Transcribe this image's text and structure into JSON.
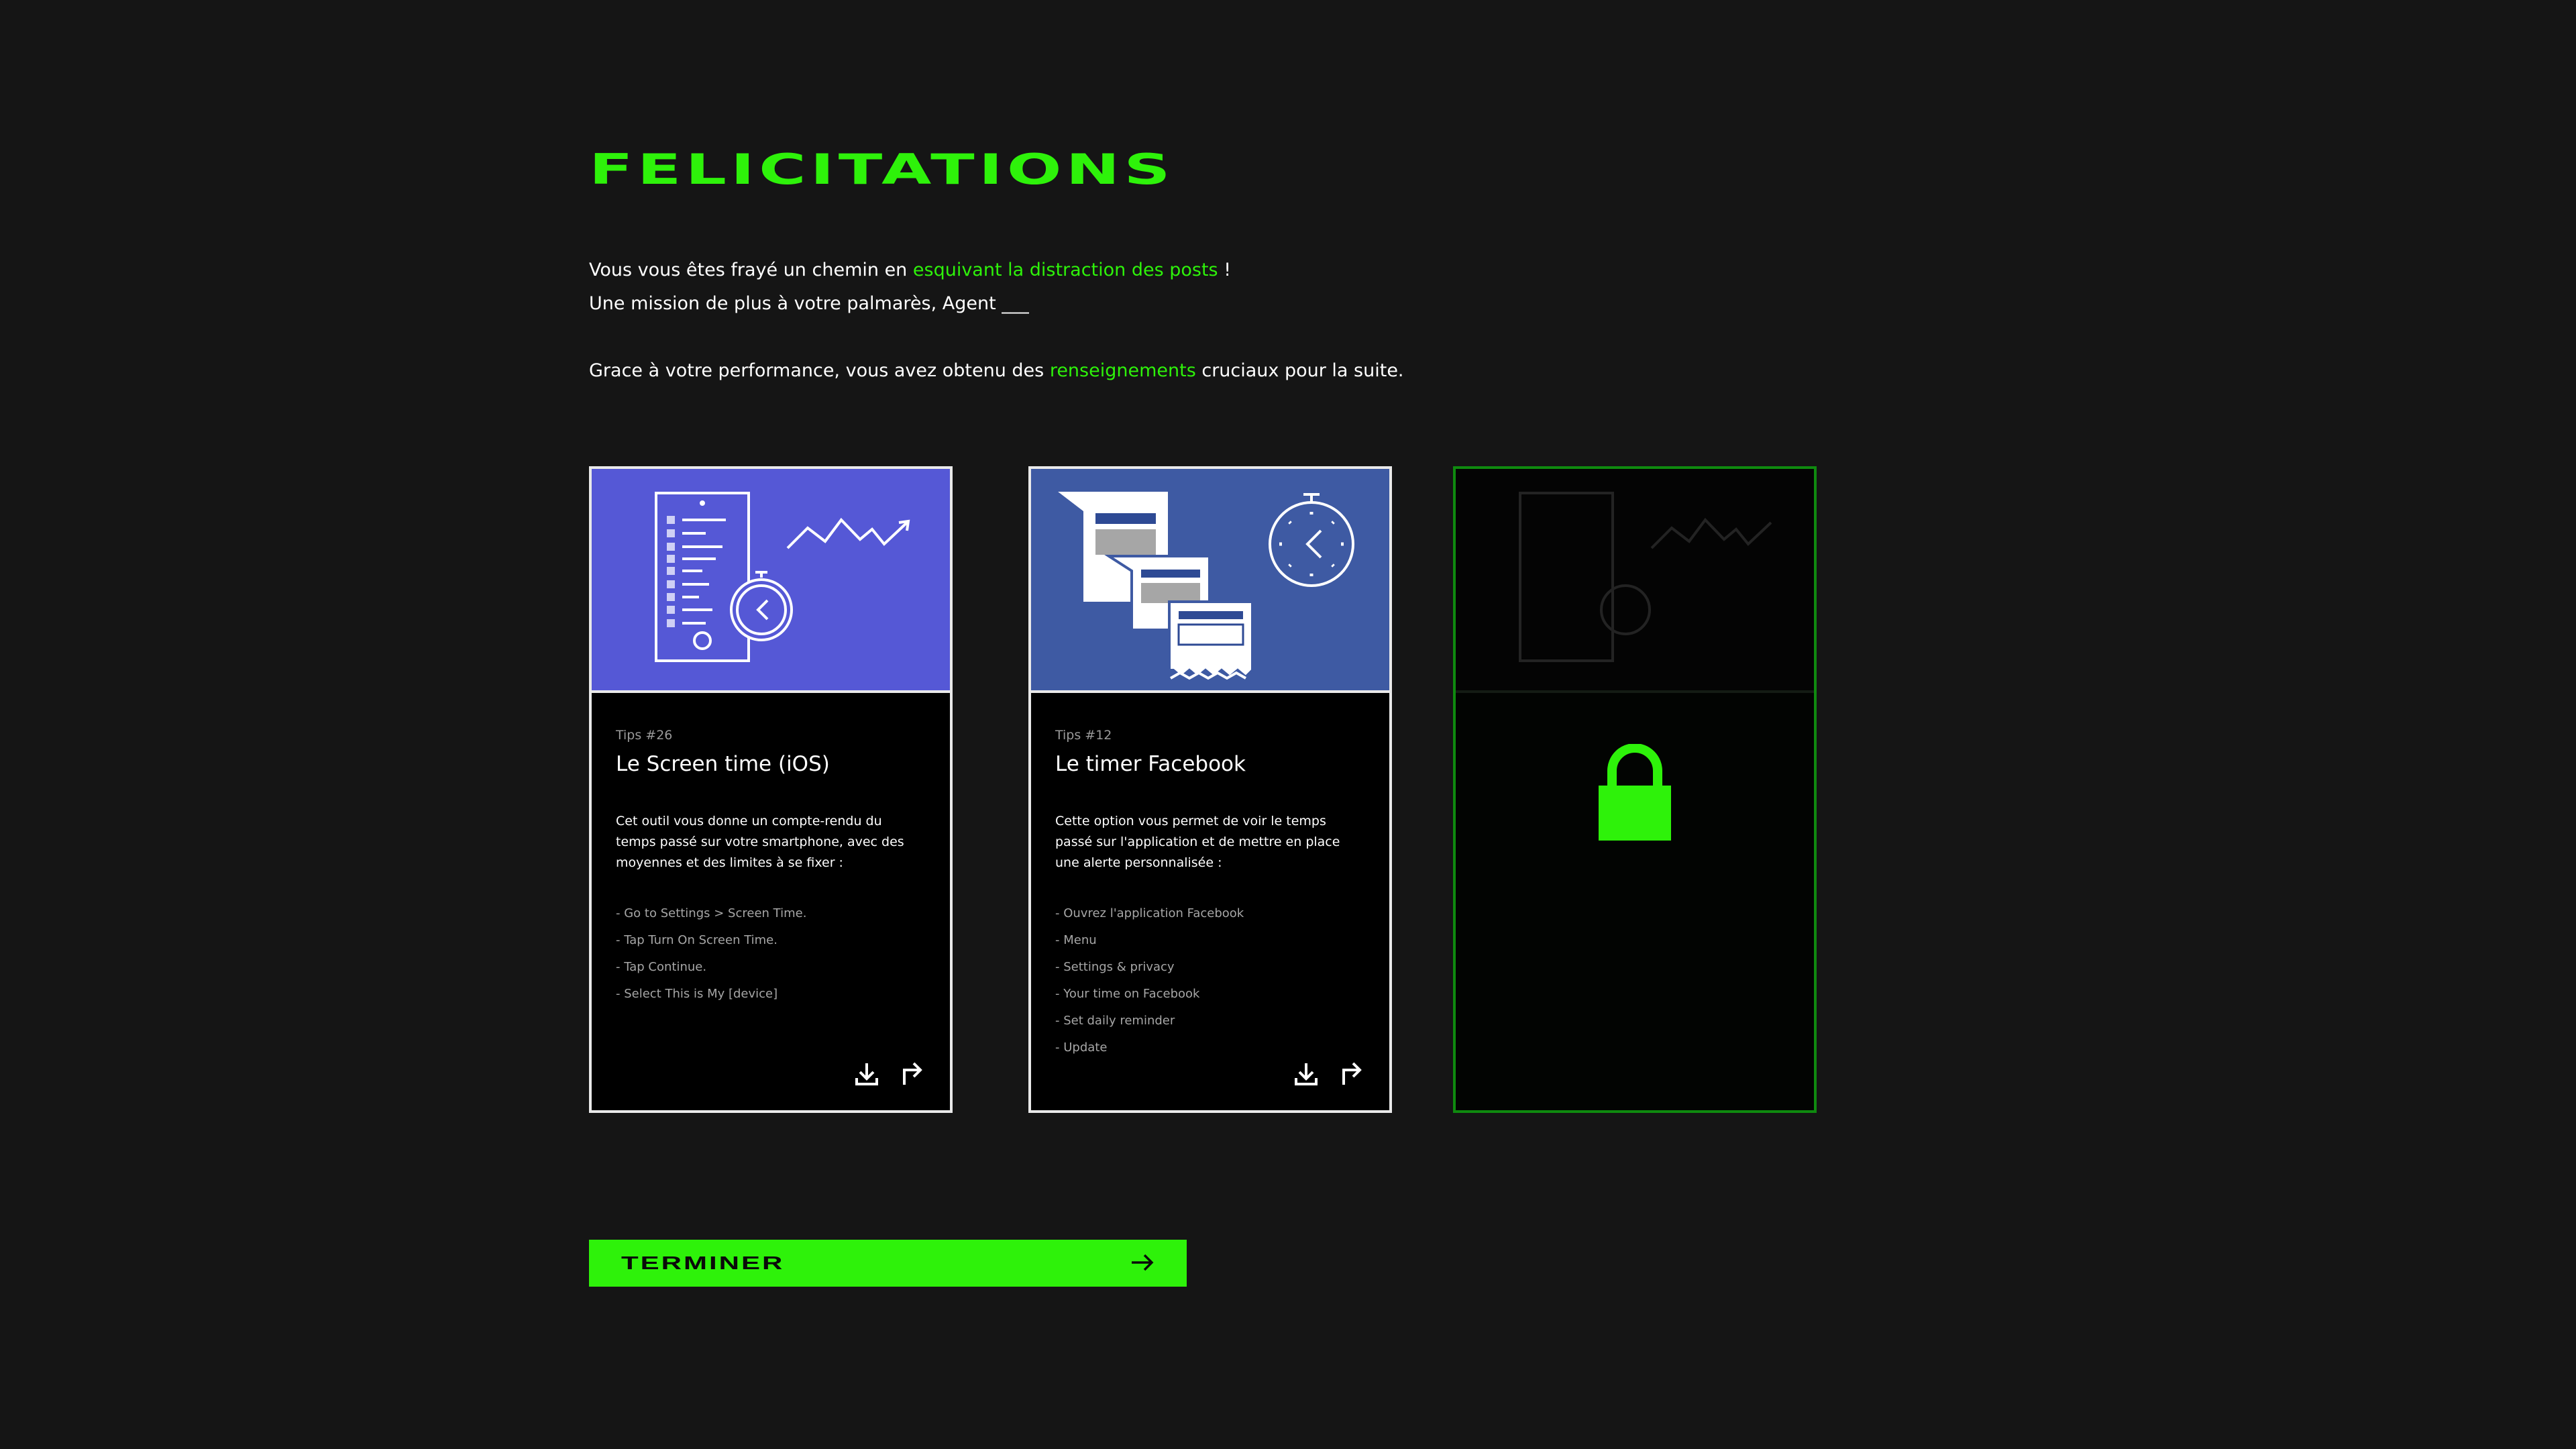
{
  "title": "FELICITATIONS",
  "intro": {
    "line1_a": "Vous vous êtes frayé un chemin en ",
    "line1_hl": "esquivant la distraction des posts",
    "line1_b": " !",
    "line2": "Une mission de plus à votre palmarès, Agent ___",
    "line3_a": "Grace à votre performance, vous avez obtenu des ",
    "line3_hl": "renseignements",
    "line3_b": "  cruciaux pour la suite."
  },
  "cards": [
    {
      "tip_number": "Tips #26",
      "title": "Le Screen time (iOS)",
      "description": "Cet outil vous donne un compte-rendu du temps passé sur votre smartphone, avec des moyennes et des limites à se fixer :",
      "steps": [
        "- Go to Settings > Screen Time.",
        "- Tap Turn On Screen Time.",
        "- Tap Continue.",
        "- Select This is My [device]"
      ],
      "banner_color": "#5558d6"
    },
    {
      "tip_number": "Tips #12",
      "title": "Le timer Facebook",
      "description": "Cette option vous permet de voir le temps passé sur l'application et de mettre en place une alerte personnalisée :",
      "steps": [
        "- Ouvrez l'application Facebook",
        "- Menu",
        "- Settings & privacy",
        "- Your time on Facebook",
        "- Set daily reminder",
        "- Update"
      ],
      "banner_color": "#3e5aa3"
    },
    {
      "locked": true,
      "lock_color": "#2ef20a",
      "border_color": "#0f8a0f"
    }
  ],
  "icons": {
    "download": "download-icon",
    "share": "share-arrow-icon",
    "lock": "padlock-icon",
    "arrow": "arrow-right-icon"
  },
  "finish_button": {
    "label": "TERMINER"
  },
  "colors": {
    "accent": "#2ef20a",
    "background": "#151515"
  }
}
